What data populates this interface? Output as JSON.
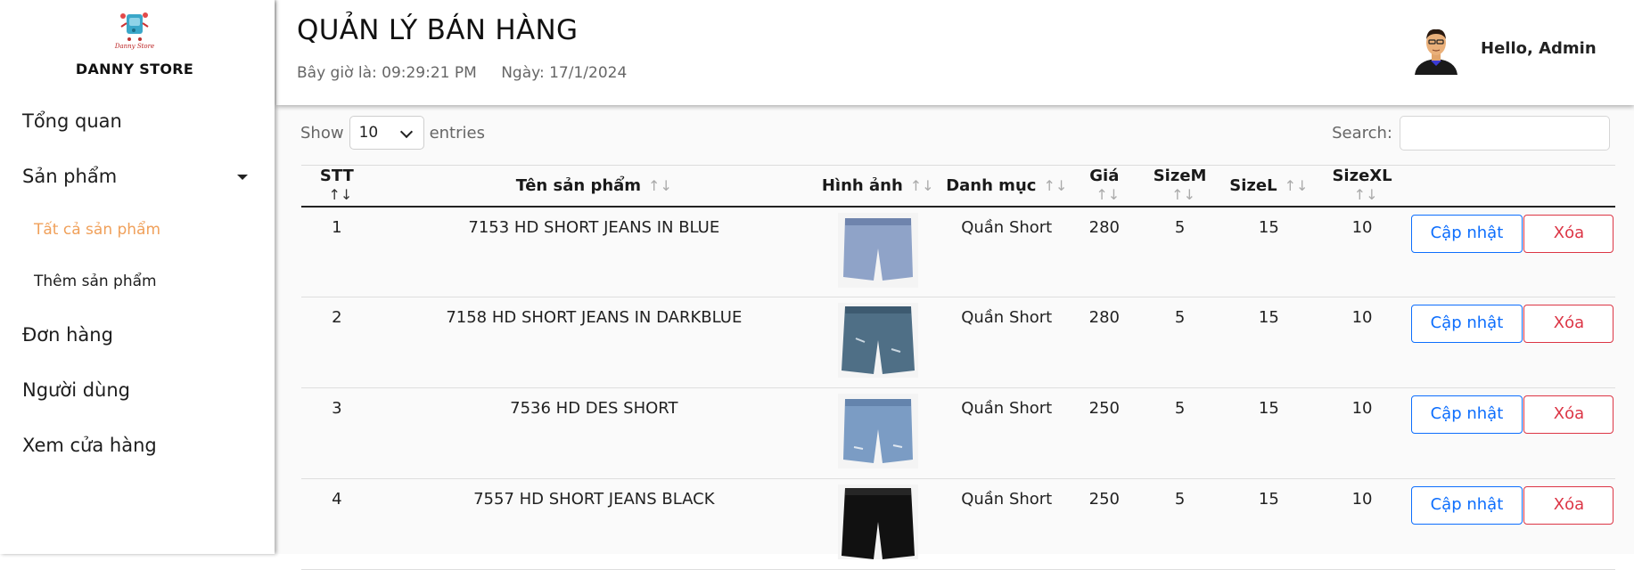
{
  "brand": {
    "logo_text": "Danny Store",
    "name": "DANNY STORE"
  },
  "nav": {
    "overview": "Tổng quan",
    "products": "Sản phẩm",
    "all_products": "Tất cả sản phẩm",
    "add_product": "Thêm sản phẩm",
    "orders": "Đơn hàng",
    "users": "Người dùng",
    "view_store": "Xem cửa hàng"
  },
  "header": {
    "title": "QUẢN LÝ BÁN HÀNG",
    "time": "Bây giờ là: 09:29:21 PM",
    "date": "Ngày: 17/1/2024",
    "greeting": "Hello, Admin"
  },
  "table_controls": {
    "show_label": "Show",
    "page_size": "10",
    "entries_label": "entries",
    "search_label": "Search:",
    "search_value": ""
  },
  "columns": [
    "STT",
    "Tên sản phẩm",
    "Hình ảnh",
    "Danh mục",
    "Giá",
    "SizeM",
    "SizeL",
    "SizeXL"
  ],
  "actions": {
    "update": "Cập nhật",
    "delete": "Xóa"
  },
  "rows": [
    {
      "stt": "1",
      "name": "7153 HD SHORT JEANS IN BLUE",
      "category": "Quần Short",
      "price": "280",
      "size_m": "5",
      "size_l": "15",
      "size_xl": "10",
      "image": "light-blue-denim-shorts"
    },
    {
      "stt": "2",
      "name": "7158 HD SHORT JEANS IN DARKBLUE",
      "category": "Quần Short",
      "price": "280",
      "size_m": "5",
      "size_l": "15",
      "size_xl": "10",
      "image": "dark-blue-ripped-denim-shorts"
    },
    {
      "stt": "3",
      "name": "7536 HD DES SHORT",
      "category": "Quần Short",
      "price": "250",
      "size_m": "5",
      "size_l": "15",
      "size_xl": "10",
      "image": "distressed-blue-denim-shorts"
    },
    {
      "stt": "4",
      "name": "7557 HD SHORT JEANS BLACK",
      "category": "Quần Short",
      "price": "250",
      "size_m": "5",
      "size_l": "15",
      "size_xl": "10",
      "image": "black-denim-shorts"
    }
  ],
  "colors": {
    "accent": "#f0a05a",
    "update": "#0d6efd",
    "delete": "#dc3545"
  }
}
